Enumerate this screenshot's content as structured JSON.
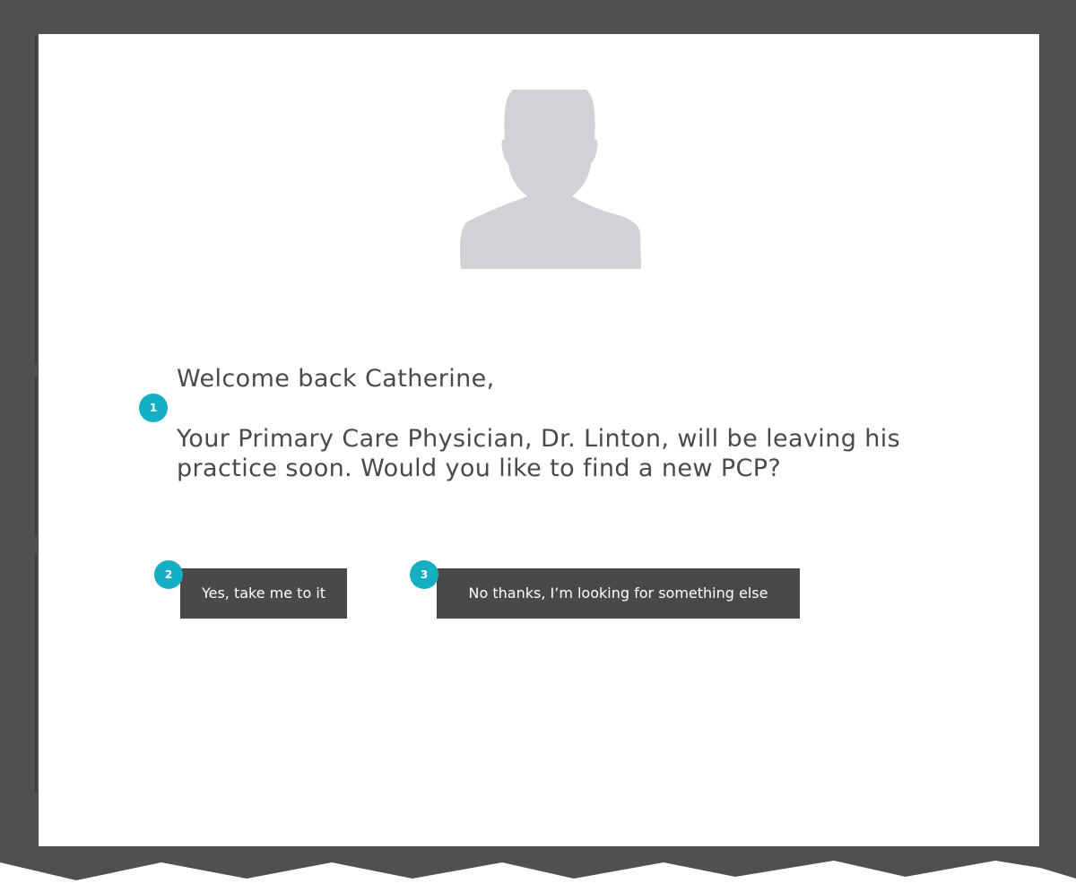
{
  "colors": {
    "frame": "#514f50",
    "avatar": "#d1d1d6",
    "text": "#4a4a4a",
    "button_bg": "#4a4849",
    "badge": "#14afc4"
  },
  "avatar_icon": "person-silhouette-icon",
  "greeting": "Welcome back Catherine,",
  "message": "Your Primary Care Physician, Dr. Linton, will be leaving his practice soon. Would you like to find a new PCP?",
  "annotations": [
    "1",
    "2",
    "3"
  ],
  "buttons": {
    "yes_label": "Yes, take me to it",
    "no_label": "No thanks, I’m looking for something else"
  }
}
